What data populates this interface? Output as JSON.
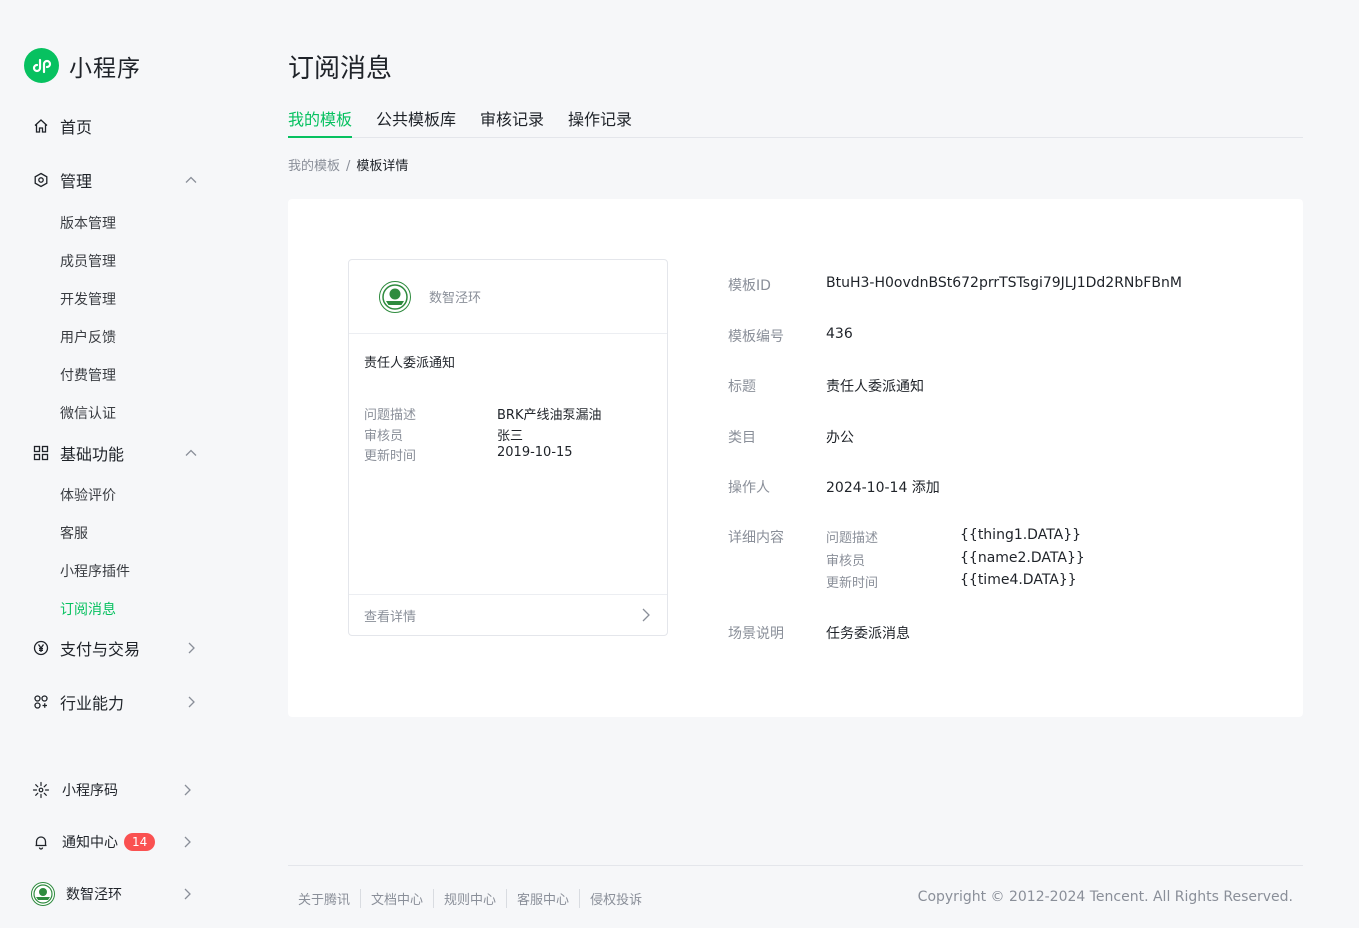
{
  "app": {
    "name": "小程序"
  },
  "sidebar": {
    "home": "首页",
    "manage": {
      "label": "管理",
      "items": [
        "版本管理",
        "成员管理",
        "开发管理",
        "用户反馈",
        "付费管理",
        "微信认证"
      ]
    },
    "basic": {
      "label": "基础功能",
      "items": [
        "体验评价",
        "客服",
        "小程序插件",
        "订阅消息"
      ],
      "active_item": "订阅消息"
    },
    "payment": "支付与交易",
    "industry": "行业能力",
    "qrcode": "小程序码",
    "notifications": {
      "label": "通知中心",
      "count": "14"
    },
    "account": "数智泾环"
  },
  "page": {
    "title": "订阅消息",
    "tabs": [
      {
        "label": "我的模板",
        "active": true
      },
      {
        "label": "公共模板库",
        "active": false
      },
      {
        "label": "审核记录",
        "active": false
      },
      {
        "label": "操作记录",
        "active": false
      }
    ],
    "breadcrumb": {
      "parent": "我的模板",
      "separator": "/",
      "current": "模板详情"
    }
  },
  "preview_card": {
    "account_name": "数智泾环",
    "title": "责任人委派通知",
    "fields": [
      {
        "key": "问题描述",
        "value": "BRK产线油泵漏油"
      },
      {
        "key": "审核员",
        "value": "张三"
      },
      {
        "key": "更新时间",
        "value": "2019-10-15"
      }
    ],
    "footer_label": "查看详情"
  },
  "detail": {
    "template_id": {
      "key": "模板ID",
      "value": "BtuH3-H0ovdnBSt672prrTSTsgi79JLJ1Dd2RNbFBnM"
    },
    "template_no": {
      "key": "模板编号",
      "value": "436"
    },
    "title": {
      "key": "标题",
      "value": "责任人委派通知"
    },
    "category": {
      "key": "类目",
      "value": "办公"
    },
    "operator": {
      "key": "操作人",
      "value": "2024-10-14 添加"
    },
    "content": {
      "key": "详细内容",
      "fields": [
        {
          "key": "问题描述",
          "value": "{{thing1.DATA}}"
        },
        {
          "key": "审核员",
          "value": "{{name2.DATA}}"
        },
        {
          "key": "更新时间",
          "value": "{{time4.DATA}}"
        }
      ]
    },
    "scene": {
      "key": "场景说明",
      "value": "任务委派消息"
    }
  },
  "footer": {
    "links": [
      "关于腾讯",
      "文档中心",
      "规则中心",
      "客服中心",
      "侵权投诉"
    ],
    "copyright": "Copyright © 2012-2024 Tencent. All Rights Reserved."
  },
  "colors": {
    "accent": "#07c160",
    "badge": "#fa5151",
    "muted": "#8a8f99"
  }
}
